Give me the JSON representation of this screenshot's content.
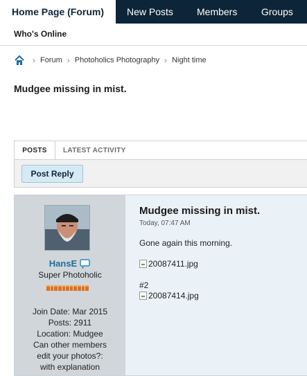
{
  "nav": {
    "active": "Home Page (Forum)",
    "links": [
      "New Posts",
      "Members",
      "Groups"
    ],
    "sub": "Who's Online"
  },
  "breadcrumb": [
    "Forum",
    "Photoholics Photography",
    "Night time"
  ],
  "thread_title": "Mudgee missing in mist.",
  "tabs": [
    "POSTS",
    "LATEST ACTIVITY"
  ],
  "toolbar": {
    "reply_label": "Post Reply"
  },
  "post": {
    "user": {
      "name": "HansE",
      "title": "Super Photoholic",
      "join_date": "Join Date: Mar 2015",
      "posts": "Posts: 2911",
      "location": "Location: Mudgee",
      "edit_line1": "Can other members",
      "edit_line2": "edit your photos?:",
      "edit_line3": "with explanation"
    },
    "title": "Mudgee missing in mist.",
    "date": "Today, 07:47 AM",
    "text": "Gone again this morning.",
    "image1": "20087411.jpg",
    "number": "#2",
    "image2": "20087414.jpg"
  },
  "colors": {
    "nav_bg": "#0d2538",
    "accent": "#1f6e9c",
    "reputation": "#e0701a"
  }
}
